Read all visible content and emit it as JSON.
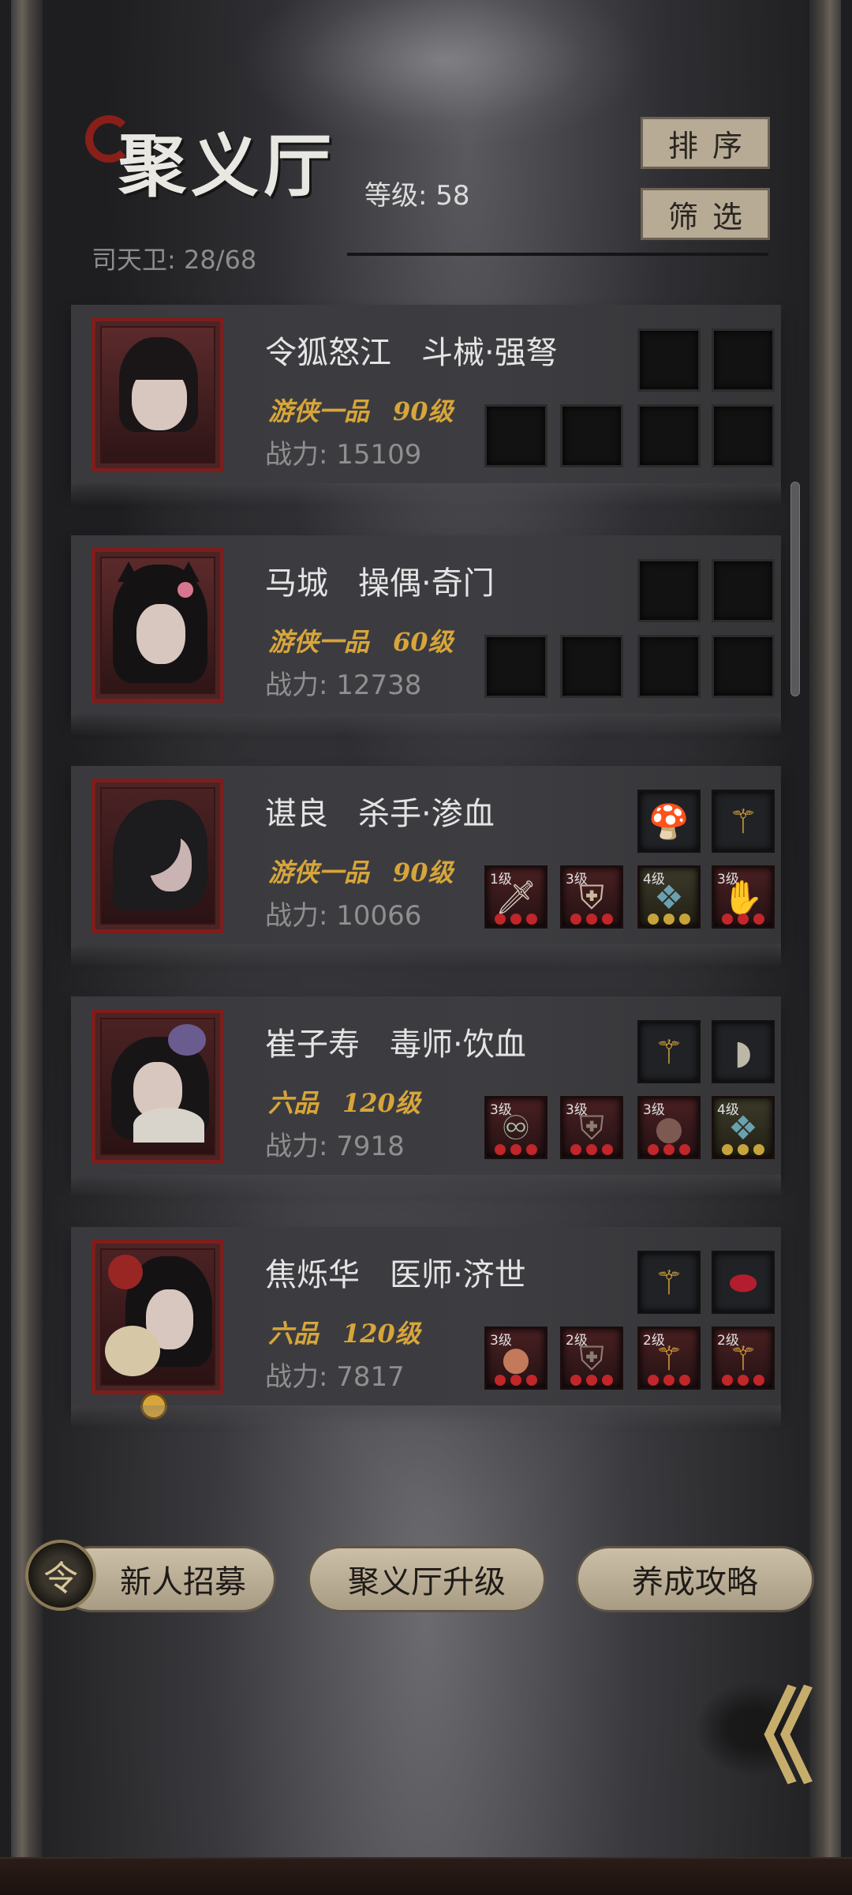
{
  "header": {
    "title": "聚义厅",
    "level_label": "等级:",
    "level_value": "58",
    "guard_text": "司天卫: 28/68",
    "sort_label": "排序",
    "filter_label": "筛选"
  },
  "colors": {
    "rank_gold": "#d7a53a",
    "portrait_border": "#7e1d1b",
    "button_beige": "#b7ab95"
  },
  "heroes": [
    {
      "name": "令狐怒江",
      "role": "斗械·强弩",
      "rank": "游侠一品",
      "level": "90级",
      "power": "战力: 15109",
      "weapons": [
        "empty",
        "empty"
      ],
      "gear": [
        {
          "lv": ""
        },
        {
          "lv": ""
        },
        {
          "lv": ""
        },
        {
          "lv": ""
        }
      ]
    },
    {
      "name": "马城",
      "role": "操偶·奇门",
      "rank": "游侠一品",
      "level": "60级",
      "power": "战力: 12738",
      "weapons": [
        "empty",
        "empty"
      ],
      "gear": [
        {
          "lv": ""
        },
        {
          "lv": ""
        },
        {
          "lv": ""
        },
        {
          "lv": ""
        }
      ]
    },
    {
      "name": "谌良",
      "role": "杀手·渗血",
      "rank": "游侠一品",
      "level": "90级",
      "power": "战力: 10066",
      "weapons": [
        "mushroom-icon",
        "golden-staff-icon"
      ],
      "gear": [
        {
          "lv": "1级"
        },
        {
          "lv": "3级"
        },
        {
          "lv": "4级"
        },
        {
          "lv": "3级"
        }
      ]
    },
    {
      "name": "崔子寿",
      "role": "毒师·饮血",
      "rank": "六品",
      "level": "120级",
      "power": "战力: 7918",
      "weapons": [
        "golden-staff-icon",
        "hand-fan-icon"
      ],
      "gear": [
        {
          "lv": "3级"
        },
        {
          "lv": "3级"
        },
        {
          "lv": "3级"
        },
        {
          "lv": "4级"
        }
      ]
    },
    {
      "name": "焦烁华",
      "role": "医师·济世",
      "rank": "六品",
      "level": "120级",
      "power": "战力: 7817",
      "weapons": [
        "golden-staff-icon",
        "red-gem-icon"
      ],
      "gear": [
        {
          "lv": "3级"
        },
        {
          "lv": "2级"
        },
        {
          "lv": "2级"
        },
        {
          "lv": "2级"
        }
      ]
    }
  ],
  "bottom": {
    "recruit_label": "新人招募",
    "upgrade_label": "聚义厅升级",
    "guide_label": "养成攻略",
    "recruit_icon_text": "令"
  },
  "nav": {
    "back_glyph": "《"
  }
}
